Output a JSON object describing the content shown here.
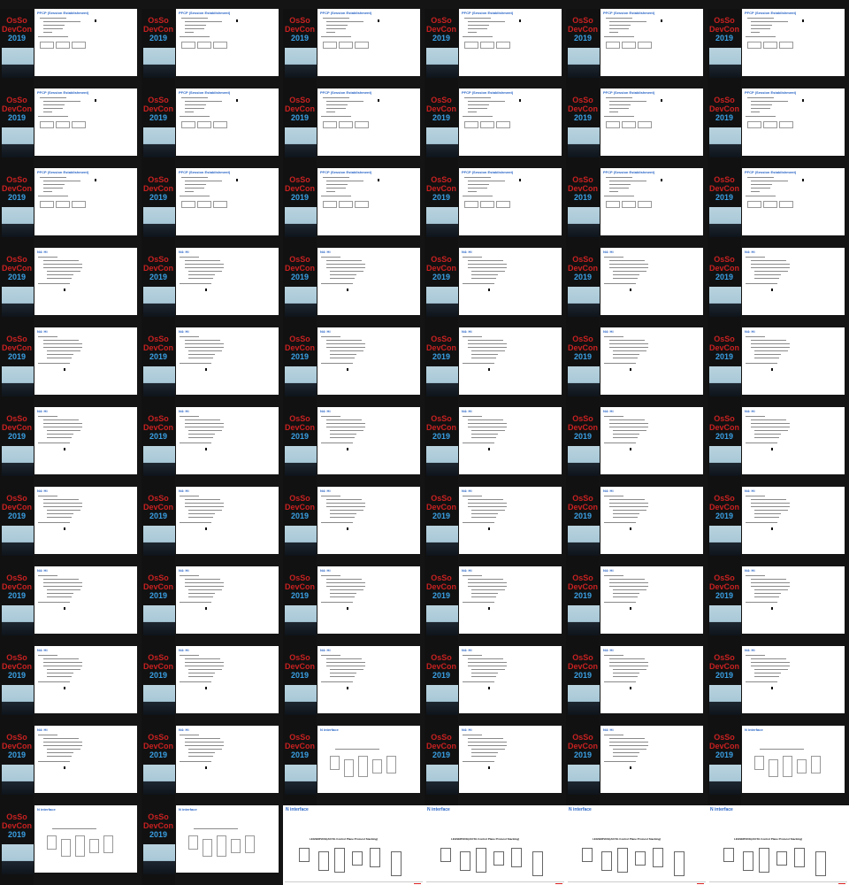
{
  "logo": {
    "line1": "OsSo",
    "line2": "DevCon",
    "line3": "2019"
  },
  "slide_types": {
    "a": {
      "title": "PFCP (Session Establishment)"
    },
    "b": {
      "title": "N4: Hi"
    },
    "c": {
      "title": "N interface"
    }
  },
  "tiles": [
    "a",
    "a",
    "a",
    "a",
    "a",
    "a",
    "a",
    "a",
    "a",
    "a",
    "a",
    "a",
    "a",
    "a",
    "a",
    "a",
    "a",
    "a",
    "b",
    "b",
    "b",
    "b",
    "b",
    "b",
    "b",
    "b",
    "b",
    "b",
    "b",
    "b",
    "b",
    "b",
    "b",
    "b",
    "b",
    "b",
    "b",
    "b",
    "b",
    "b",
    "b",
    "b",
    "b",
    "b",
    "b",
    "b",
    "b",
    "b",
    "b",
    "b",
    "b",
    "b",
    "b",
    "b",
    "b",
    "b",
    "c",
    "b",
    "b",
    "c",
    "c",
    "c",
    "full",
    "full",
    "full",
    "full"
  ],
  "full_slide": {
    "title": "N interface",
    "subtitle": "LEGSERVICE(AN 5G Control Plane Protocol Stacking)"
  }
}
